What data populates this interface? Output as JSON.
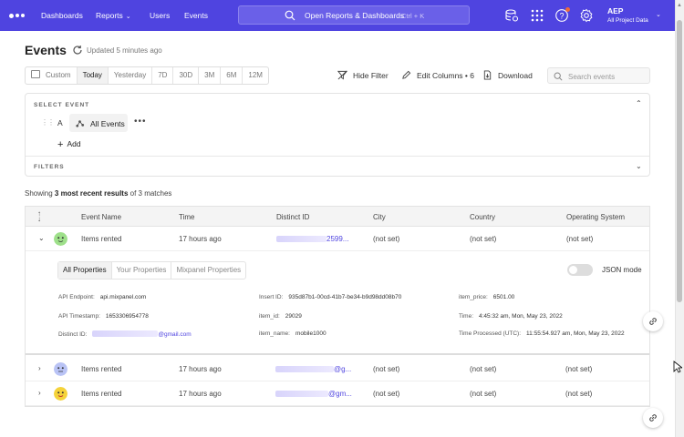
{
  "nav": {
    "links": [
      "Dashboards",
      "Reports",
      "Users",
      "Events"
    ],
    "search_label": "Open Reports & Dashboards",
    "search_shortcut": "Ctrl + K",
    "account_name": "AEP",
    "account_project": "All Project Data",
    "icons": [
      "database-icon",
      "apps-grid-icon",
      "help-icon",
      "settings-icon"
    ],
    "brand_color": "#4f44e0"
  },
  "header": {
    "title": "Events",
    "updated": "Updated 5 minutes ago"
  },
  "date_filter": {
    "options": [
      "Custom",
      "Today",
      "Yesterday",
      "7D",
      "30D",
      "3M",
      "6M",
      "12M"
    ],
    "selected": "Today"
  },
  "toolbar": {
    "hide_filter": "Hide Filter",
    "edit_columns": "Edit Columns • 6",
    "download": "Download",
    "search_placeholder": "Search events"
  },
  "select_event": {
    "title": "SELECT EVENT",
    "letter": "A",
    "event": "All Events",
    "more": "•••",
    "add": "Add",
    "filters_title": "FILTERS"
  },
  "results": {
    "prefix": "Showing ",
    "bold": "3 most recent results",
    "suffix": " of 3 matches"
  },
  "table": {
    "columns": [
      "Event Name",
      "Time",
      "Distinct ID",
      "City",
      "Country",
      "Operating System"
    ],
    "rows": [
      {
        "event": "Items rented",
        "time": "17 hours ago",
        "distinct_id_suffix": "2599...",
        "city": "(not set)",
        "country": "(not set)",
        "os": "(not set)",
        "avatar_color": "#9ee08a"
      },
      {
        "event": "Items rented",
        "time": "17 hours ago",
        "distinct_id_suffix": "@g...",
        "city": "(not set)",
        "country": "(not set)",
        "os": "(not set)",
        "avatar_color": "#b9c3f5"
      },
      {
        "event": "Items rented",
        "time": "17 hours ago",
        "distinct_id_suffix": "@gm...",
        "city": "(not set)",
        "country": "(not set)",
        "os": "(not set)",
        "avatar_color": "#f5d33a"
      }
    ]
  },
  "details": {
    "tabs": [
      "All Properties",
      "Your Properties",
      "Mixpanel Properties"
    ],
    "json_mode": "JSON mode",
    "props": {
      "api_endpoint_k": "API Endpoint:",
      "api_endpoint_v": "api.mixpanel.com",
      "api_timestamp_k": "API Timestamp:",
      "api_timestamp_v": "1653306954778",
      "distinct_id_k": "Distinct ID:",
      "distinct_id_v": "@gmail.com",
      "insert_id_k": "Insert ID:",
      "insert_id_v": "935d87b1-00cd-41b7-be34-b9d98dd08b70",
      "item_id_k": "item_id:",
      "item_id_v": "29029",
      "item_name_k": "item_name:",
      "item_name_v": "mobile1000",
      "item_price_k": "item_price:",
      "item_price_v": "6501.00",
      "time_k": "Time:",
      "time_v": "4:45:32 am, Mon, May 23, 2022",
      "time_processed_k": "Time Processed (UTC):",
      "time_processed_v": "11:55:54.927 am, Mon, May 23, 2022"
    }
  }
}
